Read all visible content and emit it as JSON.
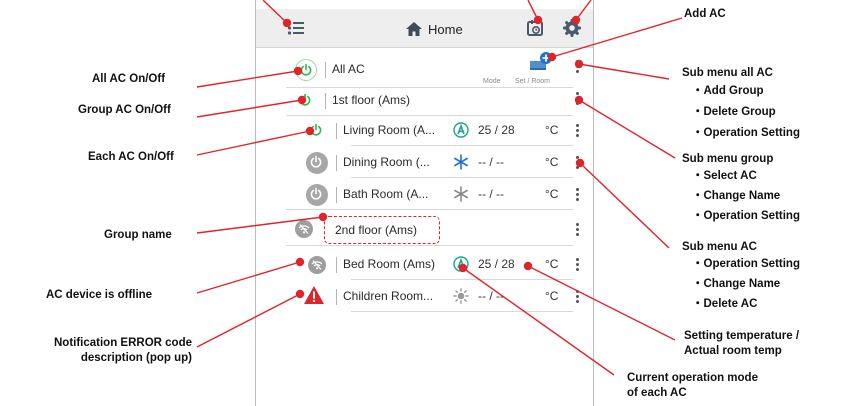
{
  "header": {
    "title": "Home"
  },
  "list": {
    "all_ac": {
      "name": "All AC",
      "mode_label": "Mode",
      "set_room_label": "Set / Room"
    },
    "rows": [
      {
        "id": "1st-floor",
        "name": "1st floor (Ams)",
        "kind": "group",
        "power": "on"
      },
      {
        "id": "living",
        "name": "Living Room (A...",
        "kind": "ac",
        "power": "on",
        "mode": "auto",
        "temp": "25 / 28",
        "unit": "°C"
      },
      {
        "id": "dining",
        "name": "Dining Room (...",
        "kind": "ac",
        "power": "off",
        "mode": "cool",
        "temp": "-- / --",
        "unit": "°C"
      },
      {
        "id": "bath",
        "name": "Bath Room (A...",
        "kind": "ac",
        "power": "off",
        "mode": "cool",
        "temp": "-- / --",
        "unit": "°C"
      },
      {
        "id": "2nd-floor",
        "name": "2nd floor (Ams)",
        "kind": "group",
        "power": "offline"
      },
      {
        "id": "bed",
        "name": "Bed Room (Ams)",
        "kind": "ac",
        "power": "offline",
        "mode": "auto",
        "temp": "25 / 28",
        "unit": "°C"
      },
      {
        "id": "children",
        "name": "Children Room...",
        "kind": "ac",
        "power": "error",
        "mode": "heat",
        "temp": "-- / --",
        "unit": "°C"
      }
    ]
  },
  "annotations": {
    "add_ac": "Add AC",
    "all_ac_onoff": "All AC On/Off",
    "group_ac_onoff": "Group AC On/Off",
    "each_ac_onoff": "Each AC On/Off",
    "group_name": "Group name",
    "offline": "AC device is offline",
    "notification_l1": "Notification ERROR code",
    "notification_l2": "description (pop up)",
    "sub_all_title": "Sub menu all AC",
    "sub_all_1": "・Add Group",
    "sub_all_2": "・Delete Group",
    "sub_all_3": "・Operation Setting",
    "sub_group_title": "Sub menu group",
    "sub_group_1": "・Select AC",
    "sub_group_2": "・Change Name",
    "sub_group_3": "・Operation Setting",
    "sub_ac_title": "Sub menu AC",
    "sub_ac_1": "・Operation  Setting",
    "sub_ac_2": "・Change Name",
    "sub_ac_3": "・Delete AC",
    "setting_temp_l1": "Setting temperature /",
    "setting_temp_l2": "Actual room temp",
    "current_mode_l1": "Current operation mode",
    "current_mode_l2": "of each AC"
  },
  "colors": {
    "accent_red": "#e0242b",
    "power_green": "#2db84a",
    "mode_teal": "#19a58a",
    "cool_blue": "#1e6fd9"
  }
}
